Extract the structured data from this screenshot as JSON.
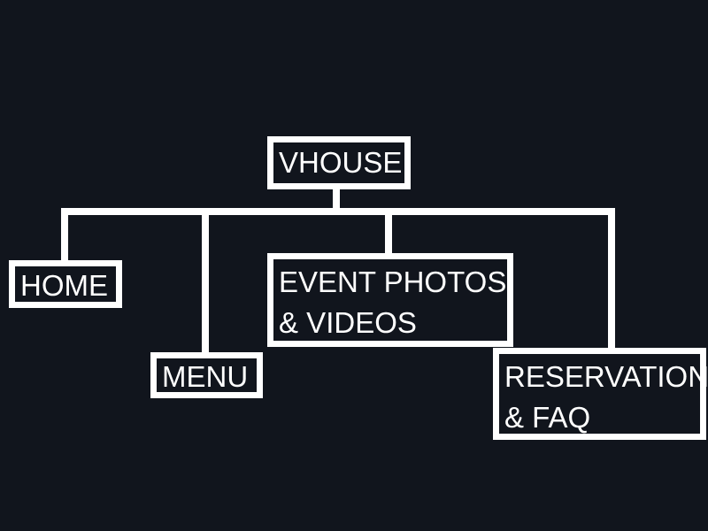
{
  "diagram": {
    "root": {
      "label": "VHOUSE"
    },
    "children": [
      {
        "id": "home",
        "lines": [
          "HOME"
        ]
      },
      {
        "id": "menu",
        "lines": [
          "MENU"
        ]
      },
      {
        "id": "event",
        "lines": [
          "EVENT PHOTOS",
          "& VIDEOS"
        ]
      },
      {
        "id": "resv",
        "lines": [
          "RESERVATION",
          "& FAQ"
        ]
      }
    ]
  },
  "colors": {
    "background": "#11151d",
    "stroke": "#ffffff",
    "text": "#ffffff"
  }
}
